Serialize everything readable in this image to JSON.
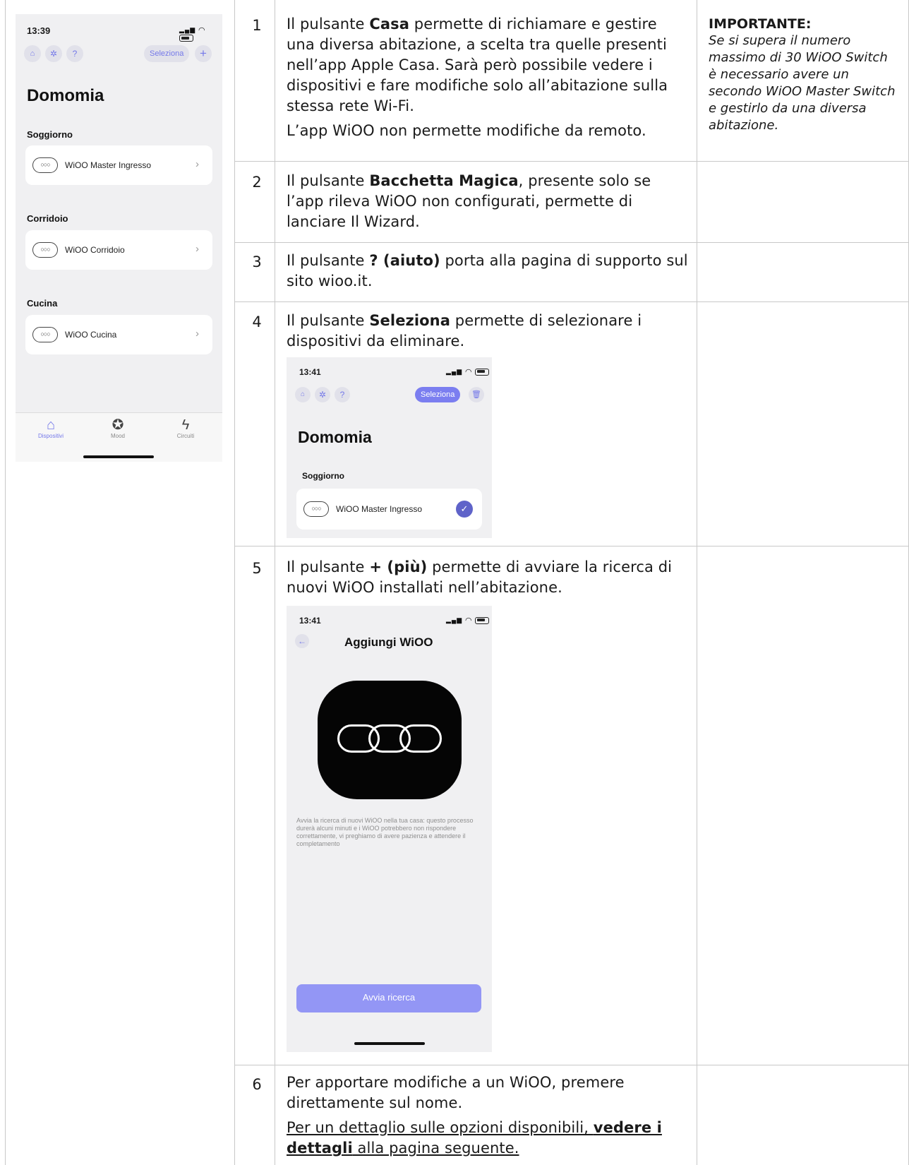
{
  "main_phone": {
    "time": "13:39",
    "battery": "21",
    "header_icons": [
      "home-icon",
      "magic-wand-icon",
      "help-icon"
    ],
    "help_glyph": "?",
    "select_label": "Seleziona",
    "add_glyph": "+",
    "home_name": "Domomia",
    "rooms": [
      {
        "name": "Soggiorno",
        "device": "WiOO Master Ingresso"
      },
      {
        "name": "Corridoio",
        "device": "WiOO Corridoio"
      },
      {
        "name": "Cucina",
        "device": "WiOO Cucina"
      }
    ],
    "tabs": [
      {
        "label": "Dispositivi",
        "icon": "house-icon"
      },
      {
        "label": "Mood",
        "icon": "palette-icon"
      },
      {
        "label": "Circuiti",
        "icon": "bolt-icon"
      }
    ]
  },
  "rows": [
    {
      "num": "1",
      "p1_pre": "Il pulsante ",
      "p1_bold": "Casa",
      "p1_post": " permette di richiamare e gestire una diversa abitazione, a scelta tra quelle presenti nell’app Apple Casa. Sarà però possibile vedere i dispositivi e fare modifiche solo all’abitazione sulla stessa rete Wi-Fi.",
      "p2": "L’app WiOO non permette modifiche da remoto.",
      "note_title": "IMPORTANTE:",
      "note_body": "Se si supera il numero massimo di 30 WiOO Switch è necessario avere un secondo WiOO Master Switch e gestirlo da una diversa abitazione."
    },
    {
      "num": "2",
      "pre": "Il pulsante ",
      "bold": "Bacchetta Magica",
      "post": ", presente solo se l’app rileva WiOO non configurati, permette di lanciare Il Wizard."
    },
    {
      "num": "3",
      "pre": "Il pulsante ",
      "bold": "? (aiuto)",
      "post": " porta alla pagina di supporto sul sito wioo.it."
    },
    {
      "num": "4",
      "pre": "Il pulsante ",
      "bold": "Seleziona",
      "post": " permette di selezionare i dispositivi da eliminare."
    },
    {
      "num": "5",
      "pre": "Il pulsante ",
      "bold": "+ (più)",
      "post": " permette di avviare la ricerca di nuovi WiOO installati nell’abitazione."
    },
    {
      "num": "6",
      "p1": "Per apportare modifiche a un WiOO, premere direttamente sul nome.",
      "link_pre": "Per un dettaglio sulle opzioni disponibili, ",
      "link_bold": "vedere i dettagli",
      "link_post": " alla pagina seguente."
    }
  ],
  "select_phone": {
    "time": "13:41",
    "select_label": "Seleziona",
    "home_name": "Domomia",
    "room": "Soggiorno",
    "device": "WiOO Master Ingresso"
  },
  "add_phone": {
    "time": "13:41",
    "title": "Aggiungi WiOO",
    "description": "Avvia la ricerca di nuovi WiOO nella tua casa: questo processo durerà alcuni minuti e i WiOO potrebbero non rispondere correttamente, vi preghiamo di avere pazienza e attendere il completamento",
    "button": "Avvia ricerca"
  },
  "colors": {
    "accent": "#7579e9",
    "accent_active": "#7b7ef0",
    "check": "#5f63c9",
    "button": "#9396f5",
    "grid": "#c8c8c8"
  }
}
